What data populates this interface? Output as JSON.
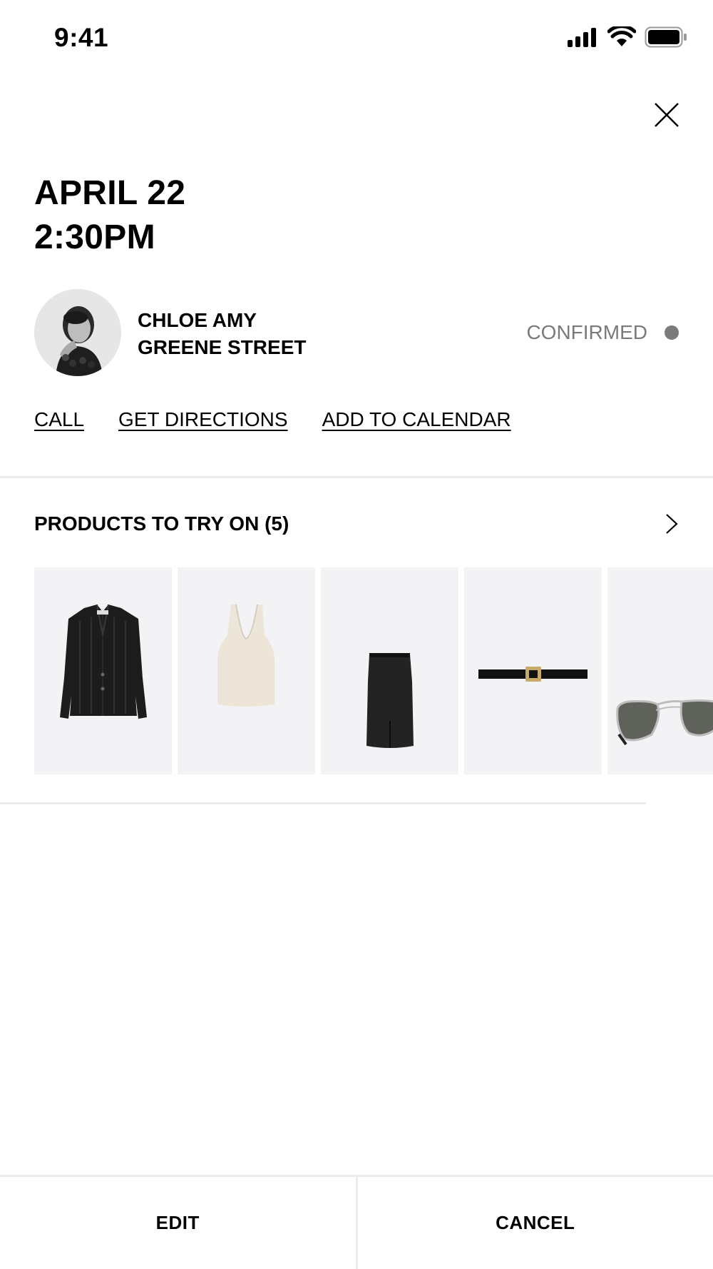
{
  "status_bar": {
    "time": "9:41",
    "icons": [
      "signal-icon",
      "wifi-icon",
      "battery-icon"
    ]
  },
  "header": {
    "close_icon": "close-icon"
  },
  "appointment": {
    "date": "APRIL 22",
    "time": "2:30PM",
    "client_name": "CHLOE AMY",
    "store": "GREENE STREET",
    "status": "CONFIRMED",
    "status_color": "#7a7a7a"
  },
  "actions": [
    {
      "label": "CALL"
    },
    {
      "label": "GET DIRECTIONS"
    },
    {
      "label": "ADD TO CALENDAR"
    }
  ],
  "products_section": {
    "title": "PRODUCTS TO TRY ON (5)",
    "chevron_icon": "chevron-right-icon",
    "items": [
      {
        "kind": "jacket"
      },
      {
        "kind": "tank-top"
      },
      {
        "kind": "skirt"
      },
      {
        "kind": "belt"
      },
      {
        "kind": "sunglasses"
      }
    ]
  },
  "footer": {
    "edit_label": "EDIT",
    "cancel_label": "CANCEL"
  },
  "colors": {
    "tile_background": "#f3f3f5",
    "divider": "#ececec",
    "muted_text": "#7a7a7a"
  }
}
